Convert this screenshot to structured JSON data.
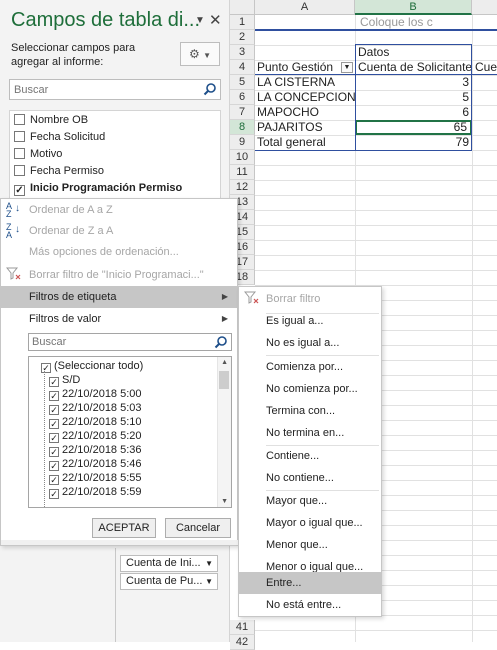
{
  "pane": {
    "title": "Campos de tabla di...",
    "caret_icon": "chevron-down-icon",
    "close_icon": "close-icon",
    "description": "Seleccionar campos para agregar al informe:",
    "gear_icon": "gear-icon",
    "search_placeholder": "Buscar",
    "fields": [
      {
        "label": "Nombre OB",
        "checked": false
      },
      {
        "label": "Fecha Solicitud",
        "checked": false
      },
      {
        "label": "Motivo",
        "checked": false
      },
      {
        "label": "Fecha Permiso",
        "checked": false
      },
      {
        "label": "Inicio Programación Permiso",
        "checked": true
      }
    ],
    "value_area_items": [
      "Cuenta de Ini...",
      "Cuenta de Pu..."
    ]
  },
  "sheet": {
    "columns": [
      "A",
      "B"
    ],
    "selected_column": "B",
    "selected_row": "8",
    "rows": [
      "1",
      "2",
      "3",
      "4",
      "5",
      "6",
      "7",
      "8",
      "9",
      "10",
      "11",
      "12",
      "13",
      "14",
      "15",
      "16",
      "17",
      "18",
      "41",
      "42"
    ],
    "placeholder_text": "Coloque los c",
    "datos_label": "Datos",
    "header_row": {
      "a": "Punto Gestión",
      "b": "Cuenta de Solicitante",
      "c": "Cue"
    },
    "data_rows": [
      {
        "a": "LA CISTERNA",
        "b": "3"
      },
      {
        "a": "LA CONCEPCION",
        "b": "5"
      },
      {
        "a": "MAPOCHO",
        "b": "6"
      },
      {
        "a": "PAJARITOS",
        "b": "65"
      }
    ],
    "total_row": {
      "a": "Total general",
      "b": "79"
    }
  },
  "menu": {
    "sort_az": "Ordenar de A a Z",
    "sort_za": "Ordenar de Z a A",
    "more_sort": "Más opciones de ordenación...",
    "clear_filter": "Borrar filtro de \"Inicio Programaci...\"",
    "label_filters": "Filtros de etiqueta",
    "value_filters": "Filtros de valor",
    "search_placeholder": "Buscar",
    "tree_items": [
      {
        "label": "(Seleccionar todo)",
        "checked": true
      },
      {
        "label": "S/D",
        "checked": true
      },
      {
        "label": "22/10/2018 5:00",
        "checked": true
      },
      {
        "label": "22/10/2018 5:03",
        "checked": true
      },
      {
        "label": "22/10/2018 5:10",
        "checked": true
      },
      {
        "label": "22/10/2018 5:20",
        "checked": true
      },
      {
        "label": "22/10/2018 5:36",
        "checked": true
      },
      {
        "label": "22/10/2018 5:46",
        "checked": true
      },
      {
        "label": "22/10/2018 5:55",
        "checked": true
      },
      {
        "label": "22/10/2018 5:59",
        "checked": true
      }
    ],
    "accept_label": "ACEPTAR",
    "cancel_label": "Cancelar"
  },
  "submenu": {
    "clear_filter": "Borrar filtro",
    "equals": "Es igual a...",
    "not_equals": "No es igual a...",
    "begins_with": "Comienza por...",
    "not_begins_with": "No comienza por...",
    "ends_with": "Termina con...",
    "not_ends_with": "No termina en...",
    "contains": "Contiene...",
    "not_contains": "No contiene...",
    "greater": "Mayor que...",
    "greater_equal": "Mayor o igual que...",
    "less": "Menor que...",
    "less_equal": "Menor o igual que...",
    "between": "Entre...",
    "not_between": "No está entre..."
  },
  "colors": {
    "excel_green": "#217346",
    "pane_title": "#1e6e3a",
    "highlight": "#c6c6c6",
    "disabled_text": "#a6a6a6"
  }
}
